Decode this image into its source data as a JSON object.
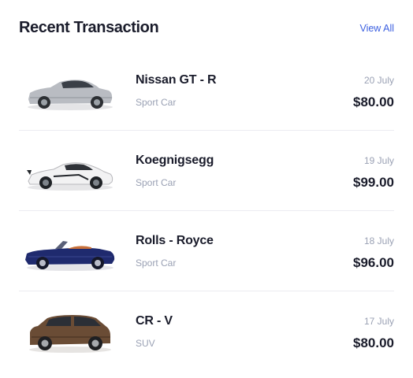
{
  "header": {
    "title": "Recent Transaction",
    "view_all": "View All"
  },
  "transactions": [
    {
      "name": "Nissan GT - R",
      "type": "Sport Car",
      "date": "20 July",
      "amount": "$80.00",
      "image": "silver-sports-car",
      "color": "#b9bcc2"
    },
    {
      "name": "Koegnigsegg",
      "type": "Sport Car",
      "date": "19 July",
      "amount": "$99.00",
      "image": "white-hypercar",
      "color": "#f1f1f1"
    },
    {
      "name": "Rolls - Royce",
      "type": "Sport Car",
      "date": "18 July",
      "amount": "$96.00",
      "image": "navy-convertible",
      "color": "#1f2a6e"
    },
    {
      "name": "CR - V",
      "type": "SUV",
      "date": "17 July",
      "amount": "$80.00",
      "image": "brown-suv",
      "color": "#6a4c35"
    }
  ]
}
